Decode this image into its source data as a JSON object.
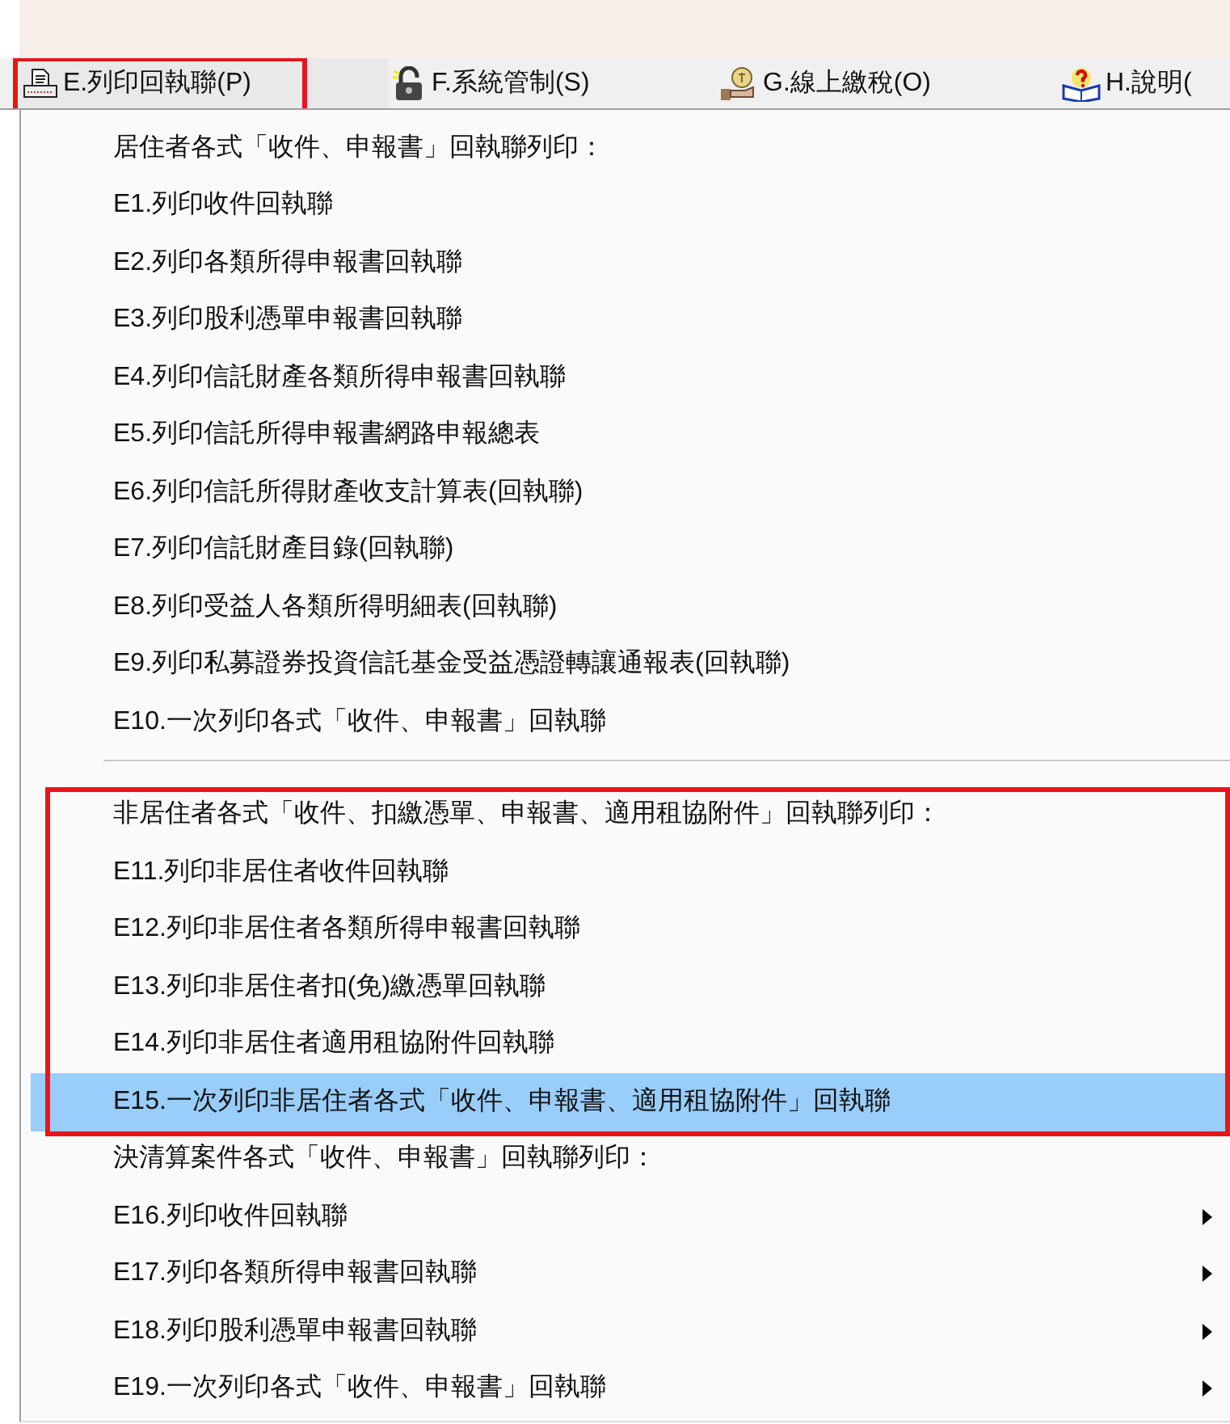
{
  "menu_bar": [
    {
      "label": "E.列印回執聯(P)",
      "selected": true,
      "annotated": true
    },
    {
      "label": "F.系統管制(S)",
      "selected": false,
      "annotated": false
    },
    {
      "label": "G.線上繳稅(O)",
      "selected": false,
      "annotated": false
    },
    {
      "label": "H.說明(",
      "selected": false,
      "annotated": false
    }
  ],
  "menu": {
    "sections": [
      {
        "header": "居住者各式「收件、申報書」回執聯列印：",
        "separator_before": false,
        "annotated": false,
        "items": [
          {
            "label": "E1.列印收件回執聯",
            "selected": false,
            "submenu": false
          },
          {
            "label": "E2.列印各類所得申報書回執聯",
            "selected": false,
            "submenu": false
          },
          {
            "label": "E3.列印股利憑單申報書回執聯",
            "selected": false,
            "submenu": false
          },
          {
            "label": "E4.列印信託財產各類所得申報書回執聯",
            "selected": false,
            "submenu": false
          },
          {
            "label": "E5.列印信託所得申報書網路申報總表",
            "selected": false,
            "submenu": false
          },
          {
            "label": "E6.列印信託所得財產收支計算表(回執聯)",
            "selected": false,
            "submenu": false
          },
          {
            "label": "E7.列印信託財產目錄(回執聯)",
            "selected": false,
            "submenu": false
          },
          {
            "label": "E8.列印受益人各類所得明細表(回執聯)",
            "selected": false,
            "submenu": false
          },
          {
            "label": "E9.列印私募證券投資信託基金受益憑證轉讓通報表(回執聯)",
            "selected": false,
            "submenu": false
          },
          {
            "label": "E10.一次列印各式「收件、申報書」回執聯",
            "selected": false,
            "submenu": false
          }
        ]
      },
      {
        "header": "非居住者各式「收件、扣繳憑單、申報書、適用租協附件」回執聯列印：",
        "separator_before": true,
        "annotated": true,
        "items": [
          {
            "label": "E11.列印非居住者收件回執聯",
            "selected": false,
            "submenu": false
          },
          {
            "label": "E12.列印非居住者各類所得申報書回執聯",
            "selected": false,
            "submenu": false
          },
          {
            "label": "E13.列印非居住者扣(免)繳憑單回執聯",
            "selected": false,
            "submenu": false
          },
          {
            "label": "E14.列印非居住者適用租協附件回執聯",
            "selected": false,
            "submenu": false
          },
          {
            "label": "E15.一次列印非居住者各式「收件、申報書、適用租協附件」回執聯",
            "selected": true,
            "submenu": false
          }
        ]
      },
      {
        "header": "決清算案件各式「收件、申報書」回執聯列印：",
        "separator_before": false,
        "annotated": false,
        "items": [
          {
            "label": "E16.列印收件回執聯",
            "selected": false,
            "submenu": true
          },
          {
            "label": "E17.列印各類所得申報書回執聯",
            "selected": false,
            "submenu": true
          },
          {
            "label": "E18.列印股利憑單申報書回執聯",
            "selected": false,
            "submenu": true
          },
          {
            "label": "E19.一次列印各式「收件、申報書」回執聯",
            "selected": false,
            "submenu": true
          }
        ]
      }
    ]
  }
}
